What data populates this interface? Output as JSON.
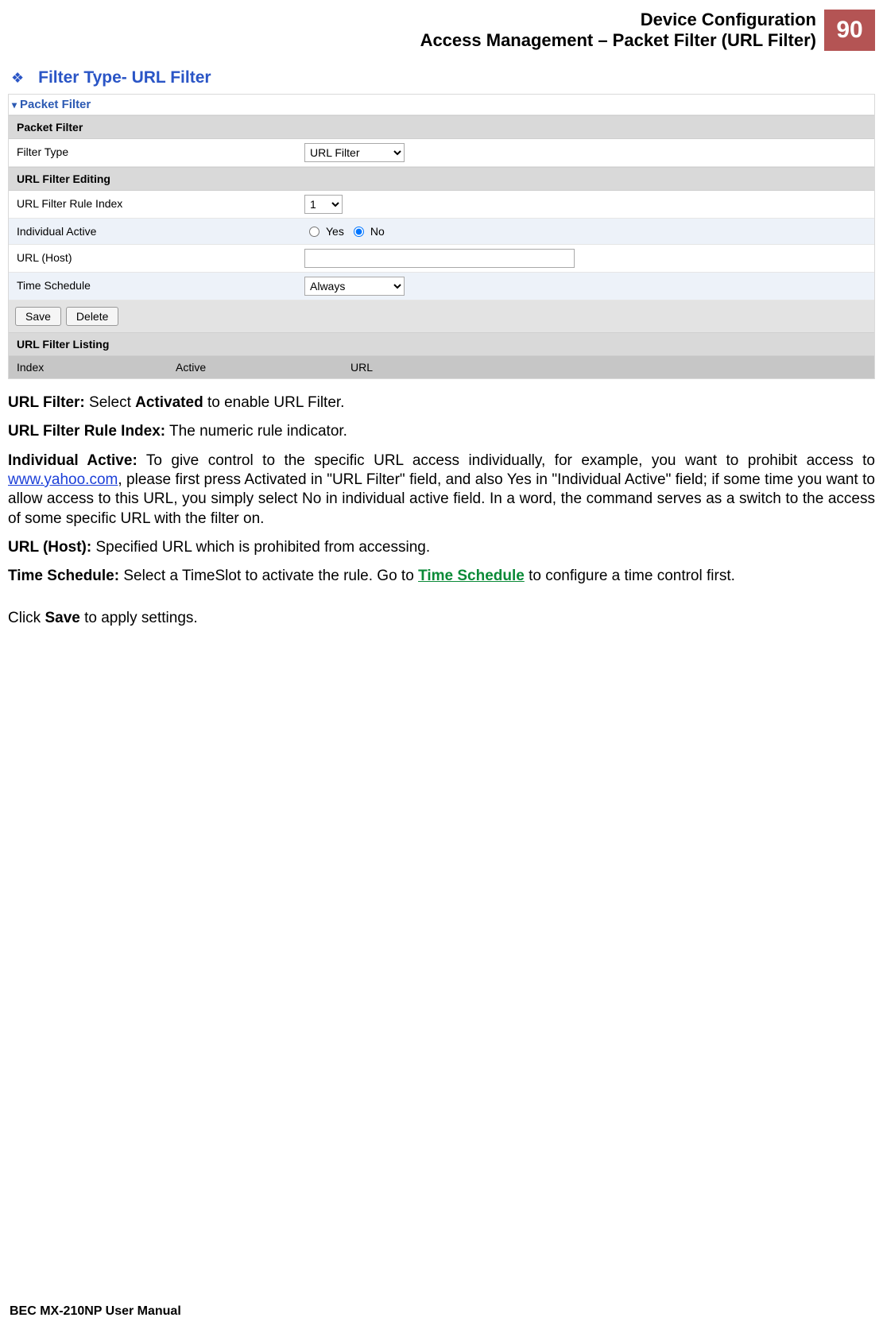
{
  "header": {
    "line1": "Device Configuration",
    "line2": "Access Management – Packet Filter (URL Filter)",
    "page": "90"
  },
  "section_title": "Filter Type- URL Filter",
  "panel": {
    "title": "Packet Filter",
    "section1": "Packet Filter",
    "filter_type_label": "Filter Type",
    "filter_type_value": "URL Filter",
    "section2": "URL Filter Editing",
    "rule_index_label": "URL Filter Rule Index",
    "rule_index_value": "1",
    "individual_active_label": "Individual Active",
    "yes_label": "Yes",
    "no_label": "No",
    "url_host_label": "URL (Host)",
    "url_host_value": "",
    "time_schedule_label": "Time Schedule",
    "time_schedule_value": "Always",
    "save_label": "Save",
    "delete_label": "Delete",
    "section3": "URL Filter Listing",
    "col_index": "Index",
    "col_active": "Active",
    "col_url": "URL"
  },
  "body": {
    "p1_b": "URL Filter:",
    "p1_a": " Select ",
    "p1_c": "Activated",
    "p1_d": " to enable URL Filter.",
    "p2_b": "URL Filter Rule Index:",
    "p2_a": " The numeric rule indicator.",
    "p3_b": "Individual Active:",
    "p3_a": " To give control to the specific URL access individually, for example, you want to prohibit access to ",
    "p3_link": "www.yahoo.com",
    "p3_c": ", please first press Activated in \"URL Filter\" field, and also Yes in \"Individual Active\" field; if some time you want to allow access to this URL, you simply select No in individual active field. In a word, the command serves as a switch to the access of some specific URL with the filter on.",
    "p4_b": "URL (Host):",
    "p4_a": " Specified URL which is prohibited from accessing.",
    "p5_b": "Time Schedule:",
    "p5_a": " Select a TimeSlot to activate the rule.  Go to ",
    "p5_link": "Time Schedule",
    "p5_c": " to configure a time control first.",
    "p6_a": "Click ",
    "p6_b": "Save",
    "p6_c": " to apply settings."
  },
  "footer": "BEC MX-210NP User Manual"
}
